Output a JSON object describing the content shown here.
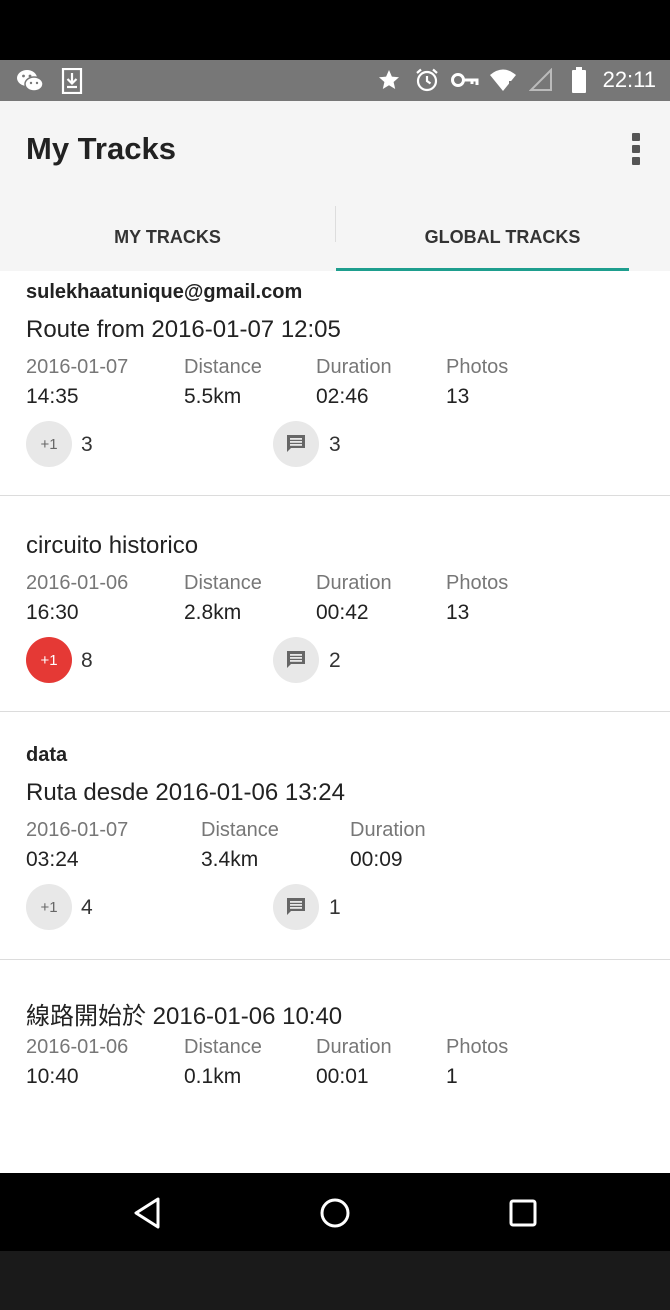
{
  "status_bar": {
    "time": "22:11",
    "left_icons": [
      "wechat-icon",
      "download-icon"
    ],
    "right_icons": [
      "star-icon",
      "alarm-icon",
      "key-icon",
      "wifi-icon",
      "signal-icon",
      "battery-icon"
    ]
  },
  "app_bar": {
    "title": "My Tracks",
    "overflow_icon": "more-vert-icon"
  },
  "tabs": [
    {
      "label": "MY TRACKS",
      "selected": false
    },
    {
      "label": "GLOBAL TRACKS",
      "selected": true
    }
  ],
  "accent_color": "#1e9e8e",
  "tracks": [
    {
      "owner": "sulekhaatunique@gmail.com",
      "name": "Route from 2016-01-07 12:05",
      "date": "2016-01-07",
      "time": "14:35",
      "distance_label": "Distance",
      "distance": "5.5km",
      "duration_label": "Duration",
      "duration": "02:46",
      "photos_label": "Photos",
      "photos": "13",
      "plus_one_label": "+1",
      "plus_one_count": "3",
      "plus_one_active": false,
      "comment_count": "3"
    },
    {
      "owner": "",
      "name": "circuito historico",
      "date": "2016-01-06",
      "time": "16:30",
      "distance_label": "Distance",
      "distance": "2.8km",
      "duration_label": "Duration",
      "duration": "00:42",
      "photos_label": "Photos",
      "photos": "13",
      "plus_one_label": "+1",
      "plus_one_count": "8",
      "plus_one_active": true,
      "comment_count": "2"
    },
    {
      "owner": "data",
      "name": "Ruta desde 2016-01-06 13:24",
      "date": "2016-01-07",
      "time": "03:24",
      "distance_label": "Distance",
      "distance": "3.4km",
      "duration_label": "Duration",
      "duration": "00:09",
      "plus_one_label": "+1",
      "plus_one_count": "4",
      "plus_one_active": false,
      "comment_count": "1"
    },
    {
      "owner": "",
      "name": "線路開始於 2016-01-06 10:40",
      "date": "2016-01-06",
      "time": "10:40",
      "distance_label": "Distance",
      "distance": "0.1km",
      "duration_label": "Duration",
      "duration": "00:01",
      "photos_label": "Photos",
      "photos": "1"
    }
  ],
  "nav_bar": {
    "buttons": [
      "back-icon",
      "home-icon",
      "recents-icon"
    ]
  }
}
